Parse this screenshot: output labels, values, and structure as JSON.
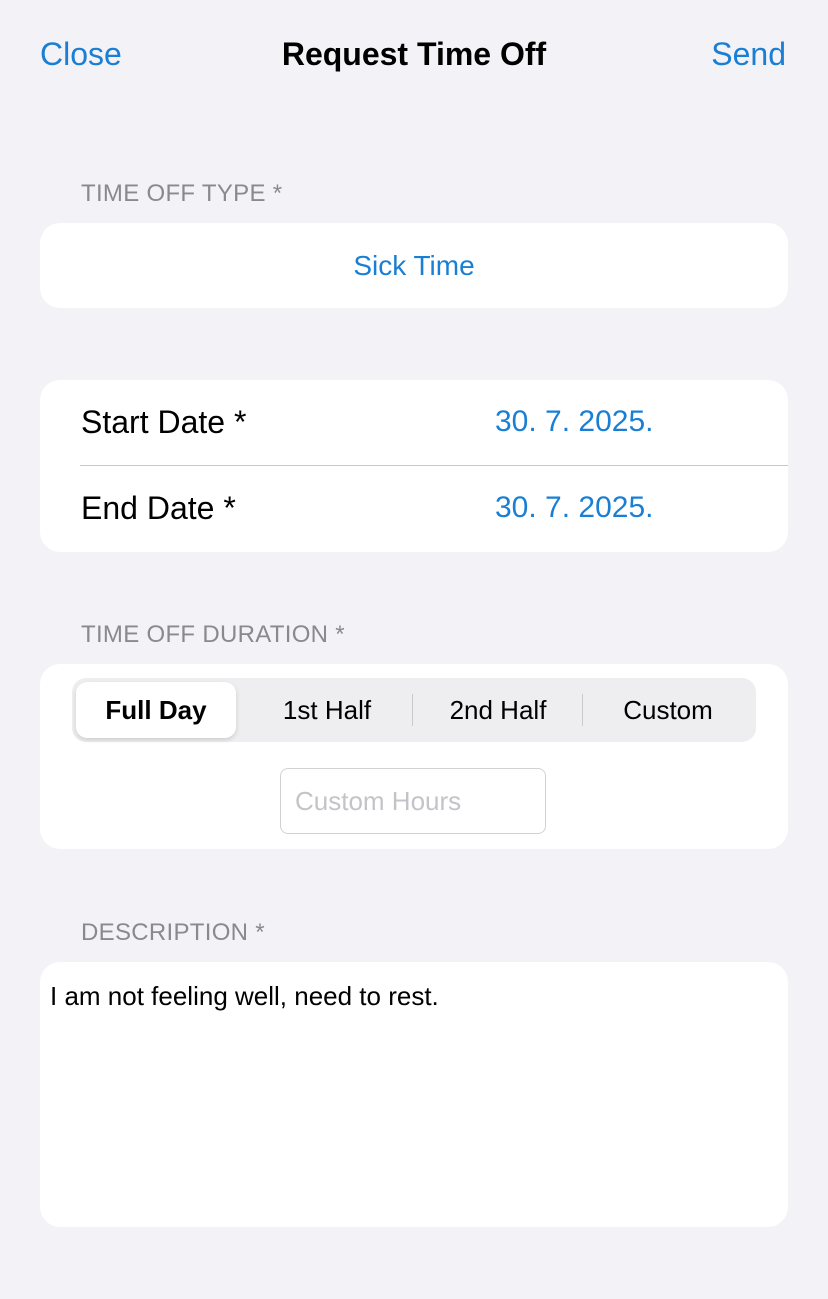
{
  "nav": {
    "close_label": "Close",
    "title": "Request Time Off",
    "send_label": "Send"
  },
  "time_off_type": {
    "label": "TIME OFF TYPE *",
    "value": "Sick Time"
  },
  "dates": {
    "start_label": "Start Date *",
    "start_value": "30. 7. 2025.",
    "end_label": "End Date *",
    "end_value": "30. 7. 2025."
  },
  "duration": {
    "label": "TIME OFF DURATION *",
    "options": [
      "Full Day",
      "1st Half",
      "2nd Half",
      "Custom"
    ],
    "selected": "Full Day",
    "custom_hours_placeholder": "Custom Hours",
    "custom_hours_value": ""
  },
  "description": {
    "label": "DESCRIPTION *",
    "value": "I am not feeling well, need to rest."
  },
  "colors": {
    "accent": "#1a7fd4",
    "background": "#f2f2f7",
    "section_label": "#8a8a8e"
  }
}
